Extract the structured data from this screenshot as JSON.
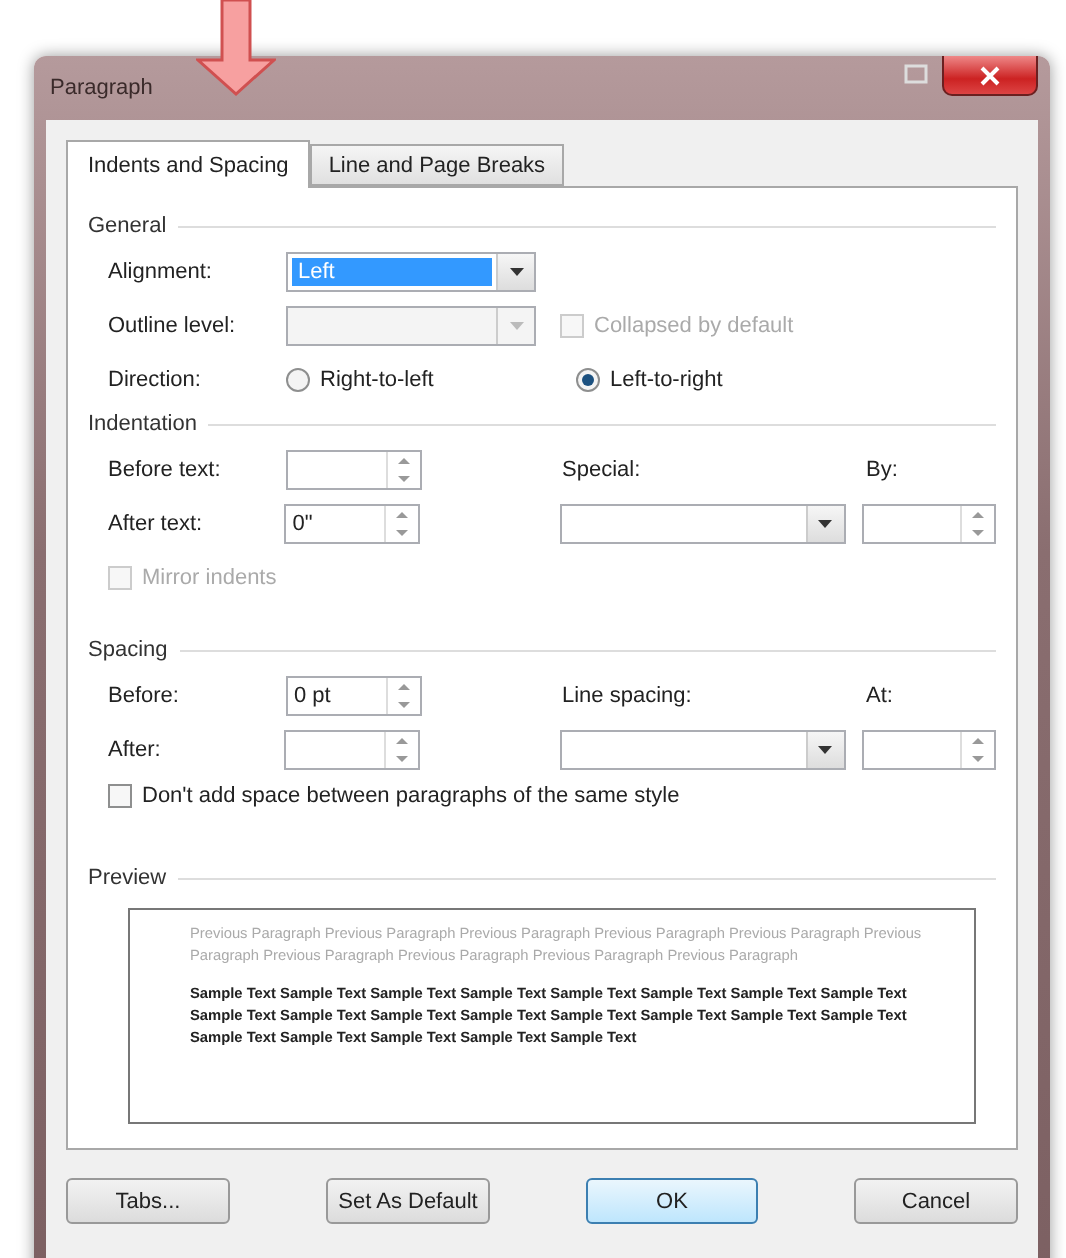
{
  "window": {
    "title": "Paragraph"
  },
  "tabs": [
    {
      "label": "Indents and Spacing",
      "selected": true
    },
    {
      "label": "Line and Page Breaks",
      "selected": false
    }
  ],
  "general": {
    "title": "General",
    "alignment": {
      "label": "Alignment:",
      "value": "Left",
      "focused": true
    },
    "outline_level": {
      "label": "Outline level:",
      "disabled": true
    },
    "collapsed": {
      "label": "Collapsed by default",
      "checked": false,
      "disabled": true
    },
    "direction": {
      "label": "Direction:",
      "options": [
        {
          "label": "Right-to-left",
          "selected": false
        },
        {
          "label": "Left-to-right",
          "selected": true
        }
      ]
    }
  },
  "indentation": {
    "title": "Indentation",
    "before_text": {
      "label": "Before text:"
    },
    "after_text": {
      "label": "After text:",
      "value": "0\""
    },
    "special": {
      "label": "Special:"
    },
    "by": {
      "label": "By:"
    },
    "mirror": {
      "label": "Mirror indents",
      "checked": false,
      "disabled": true
    }
  },
  "spacing": {
    "title": "Spacing",
    "before": {
      "label": "Before:",
      "value": "0 pt"
    },
    "after": {
      "label": "After:"
    },
    "line_spacing": {
      "label": "Line spacing:"
    },
    "at": {
      "label": "At:"
    },
    "dont_add": {
      "label": "Don't add space between paragraphs of the same style",
      "checked": false,
      "disabled": false
    }
  },
  "preview": {
    "title": "Preview",
    "previous_text": "Previous Paragraph Previous Paragraph Previous Paragraph Previous Paragraph Previous Paragraph Previous Paragraph Previous Paragraph Previous Paragraph Previous Paragraph Previous Paragraph",
    "sample_text": "Sample Text Sample Text Sample Text Sample Text Sample Text Sample Text Sample Text Sample Text Sample Text Sample Text Sample Text Sample Text Sample Text Sample Text Sample Text Sample Text Sample Text Sample Text Sample Text Sample Text Sample Text"
  },
  "buttons": [
    {
      "label": "Tabs...",
      "default": false
    },
    {
      "label": "Set As Default",
      "default": false
    },
    {
      "label": "OK",
      "default": true
    },
    {
      "label": "Cancel",
      "default": false
    }
  ]
}
